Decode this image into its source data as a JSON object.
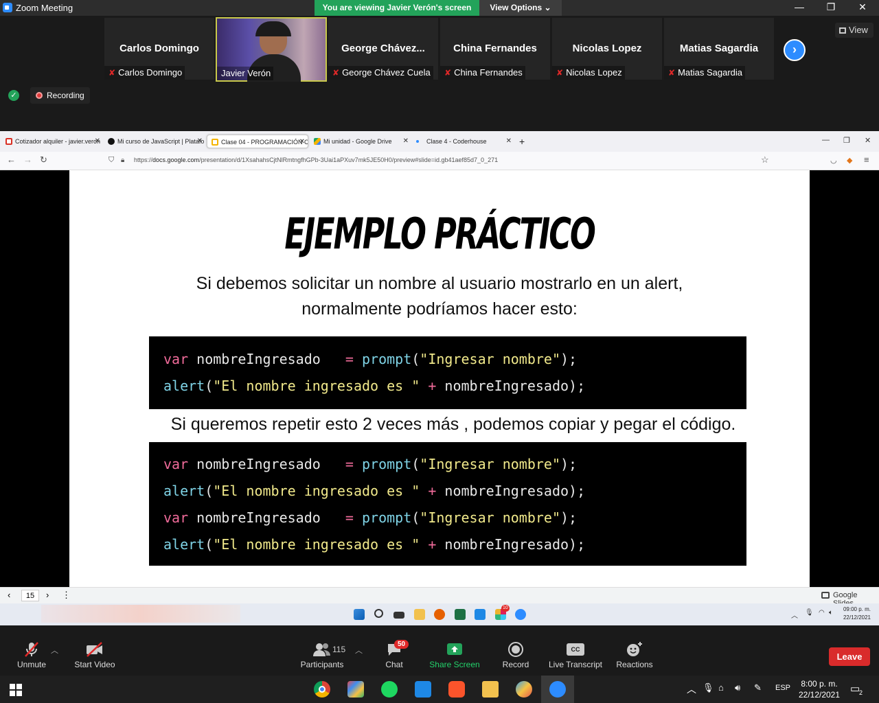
{
  "zoom": {
    "window_title": "Zoom Meeting",
    "viewing_banner": "You are viewing Javier Verón's screen",
    "view_options": "View Options",
    "view_label": "View",
    "recording_label": "Recording"
  },
  "participants": [
    {
      "big": "Carlos Domingo",
      "label": "Carlos Domingo",
      "muted": true
    },
    {
      "big": "",
      "label": "Javier Verón",
      "muted": false,
      "video": true
    },
    {
      "big": "George  Chávez...",
      "label": "George Chávez Cuela",
      "muted": true
    },
    {
      "big": "China Fernandes",
      "label": "China Fernandes",
      "muted": true
    },
    {
      "big": "Nicolas Lopez",
      "label": "Nicolas Lopez",
      "muted": true
    },
    {
      "big": "Matias Sagardia",
      "label": "Matias Sagardia",
      "muted": true
    }
  ],
  "browser": {
    "tabs": [
      {
        "title": "Cotizador alquiler - javier.veron",
        "favicon_color": "#d93025"
      },
      {
        "title": "Mi curso de JavaScript | Platafo",
        "favicon_color": "#111111"
      },
      {
        "title": "Clase 04 - PROGRAMACIÓN CO",
        "favicon_color": "#f4b400"
      },
      {
        "title": "Mi unidad - Google Drive",
        "favicon_color": "#1fa463"
      },
      {
        "title": "Clase 4 - Coderhouse",
        "favicon_color": "#2d8cff"
      }
    ],
    "new_tab": "+",
    "url_prefix": "https://",
    "url_host": "docs.google.com",
    "url_path": "/presentation/d/1XsahahsCjtNlRmtngfhGPb-3Uai1aPXuv7mk5JE50H0/preview#slide=id.gb41aef85d7_0_271"
  },
  "slide": {
    "title": "EJEMPLO PRÁCTICO",
    "intro_line1": "Si debemos solicitar un nombre al usuario mostrarlo en un alert,",
    "intro_line2": "normalmente podríamos hacer esto:",
    "middle_text": "Si queremos repetir esto 2 veces más , podemos copiar y pegar el código.",
    "code_block_1": [
      [
        [
          "kw",
          "var"
        ],
        [
          "id",
          " nombreIngresado   "
        ],
        [
          "op",
          "= "
        ],
        [
          "fn",
          "prompt"
        ],
        [
          "pn",
          "("
        ],
        [
          "st",
          "\"Ingresar nombre\""
        ],
        [
          "pn",
          ");"
        ]
      ],
      [
        [
          "fn",
          "alert"
        ],
        [
          "pn",
          "("
        ],
        [
          "st",
          "\"El nombre ingresado es \""
        ],
        [
          "op",
          " + "
        ],
        [
          "id",
          "nombreIngresado"
        ],
        [
          "pn",
          ");"
        ]
      ]
    ],
    "code_block_2": [
      [
        [
          "kw",
          "var"
        ],
        [
          "id",
          " nombreIngresado   "
        ],
        [
          "op",
          "= "
        ],
        [
          "fn",
          "prompt"
        ],
        [
          "pn",
          "("
        ],
        [
          "st",
          "\"Ingresar nombre\""
        ],
        [
          "pn",
          ");"
        ]
      ],
      [
        [
          "fn",
          "alert"
        ],
        [
          "pn",
          "("
        ],
        [
          "st",
          "\"El nombre ingresado es \""
        ],
        [
          "op",
          " + "
        ],
        [
          "id",
          "nombreIngresado"
        ],
        [
          "pn",
          ");"
        ]
      ],
      [
        [
          "kw",
          "var"
        ],
        [
          "id",
          " nombreIngresado   "
        ],
        [
          "op",
          "= "
        ],
        [
          "fn",
          "prompt"
        ],
        [
          "pn",
          "("
        ],
        [
          "st",
          "\"Ingresar nombre\""
        ],
        [
          "pn",
          ");"
        ]
      ],
      [
        [
          "fn",
          "alert"
        ],
        [
          "pn",
          "("
        ],
        [
          "st",
          "\"El nombre ingresado es \""
        ],
        [
          "op",
          " + "
        ],
        [
          "id",
          "nombreIngresado"
        ],
        [
          "pn",
          ");"
        ]
      ]
    ],
    "page_number": "15",
    "brand": "Google Slides"
  },
  "inner_tray": {
    "time": "09:00 p. m.",
    "date": "22/12/2021",
    "slack_badge": "10"
  },
  "toolbar": {
    "unmute": "Unmute",
    "start_video": "Start Video",
    "participants": "Participants",
    "participants_count": "115",
    "chat": "Chat",
    "chat_badge": "50",
    "share_screen": "Share Screen",
    "record": "Record",
    "live_transcript": "Live Transcript",
    "cc": "CC",
    "reactions": "Reactions",
    "leave": "Leave"
  },
  "taskbar": {
    "lang": "ESP",
    "time": "8:00 p. m.",
    "date": "22/12/2021",
    "notif_count": "2"
  },
  "colors": {
    "zoom_blue": "#2d8cff",
    "share_green": "#23a35a",
    "leave_red": "#d92b2b",
    "muted_red": "#e02828"
  }
}
